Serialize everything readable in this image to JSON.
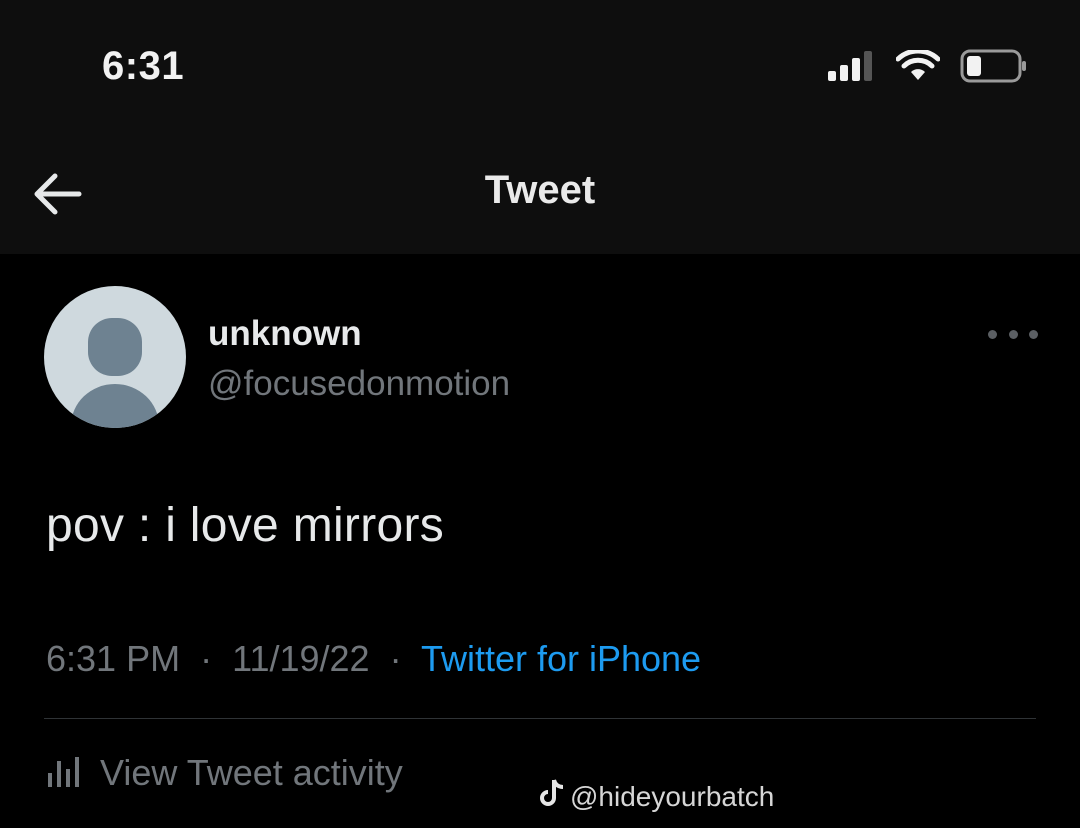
{
  "status_bar": {
    "time": "6:31",
    "icons": [
      "signal-icon",
      "wifi-icon",
      "battery-icon"
    ]
  },
  "nav": {
    "back_icon": "arrow-left-icon",
    "title": "Tweet"
  },
  "tweet": {
    "avatar_icon": "default-avatar-icon",
    "author_name": "unknown",
    "author_handle": "@focusedonmotion",
    "more_icon": "more-horizontal-icon",
    "text": "pov : i love mirrors",
    "time": "6:31 PM",
    "separator": "·",
    "date": "11/19/22",
    "source": "Twitter for iPhone",
    "activity_label": "View Tweet activity",
    "activity_icon": "bar-chart-icon"
  },
  "watermark": {
    "icon": "tiktok-icon",
    "text": "@hideyourbatch"
  },
  "colors": {
    "background": "#000000",
    "bar_background": "#0e0e0e",
    "primary_text": "#e7e9ea",
    "secondary_text": "#71767b",
    "link": "#1d9bf0",
    "divider": "#2f3336"
  }
}
